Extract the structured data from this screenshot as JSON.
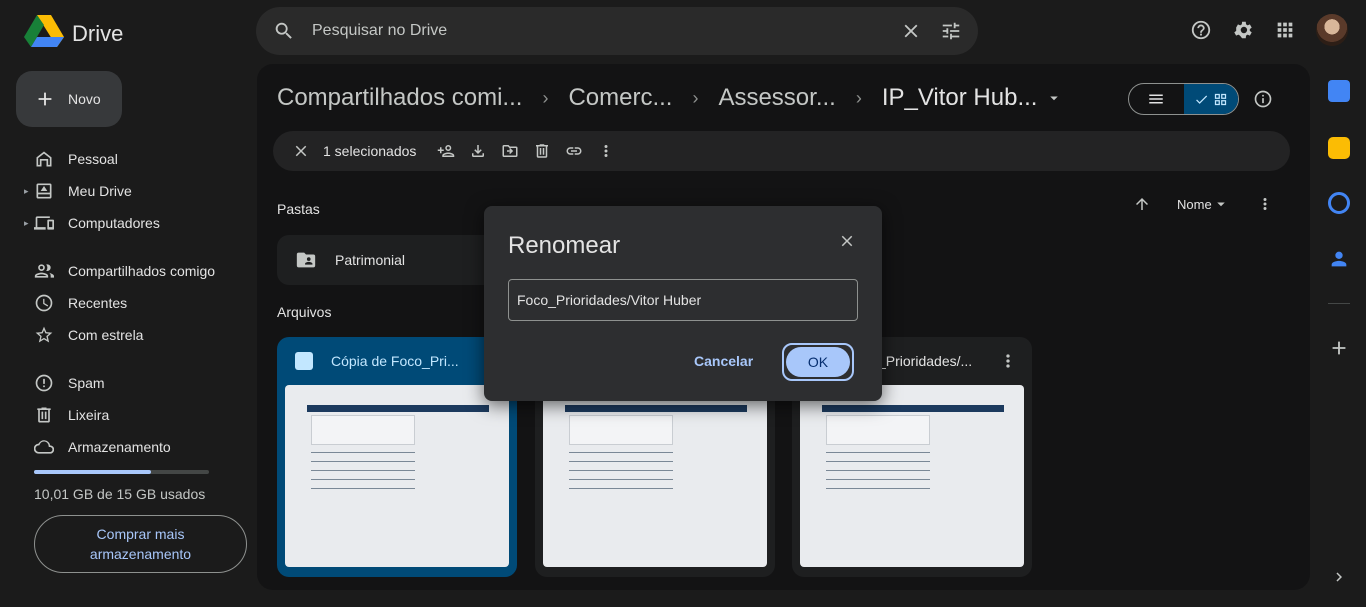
{
  "app": {
    "name": "Drive"
  },
  "search": {
    "placeholder": "Pesquisar no Drive"
  },
  "sidebar": {
    "new_label": "Novo",
    "items": [
      {
        "label": "Pessoal"
      },
      {
        "label": "Meu Drive"
      },
      {
        "label": "Computadores"
      },
      {
        "label": "Compartilhados comigo"
      },
      {
        "label": "Recentes"
      },
      {
        "label": "Com estrela"
      },
      {
        "label": "Spam"
      },
      {
        "label": "Lixeira"
      },
      {
        "label": "Armazenamento"
      }
    ],
    "storage_used_fraction": 0.667,
    "storage_text": "10,01 GB de 15 GB usados",
    "buy_label": "Comprar mais armazenamento"
  },
  "breadcrumb": {
    "items": [
      "Compartilhados comi...",
      "Comerc...",
      "Assessor..."
    ],
    "current": "IP_Vitor Hub..."
  },
  "selection": {
    "count_label": "1 selecionados"
  },
  "sections": {
    "folders": "Pastas",
    "files": "Arquivos"
  },
  "sort": {
    "label": "Nome"
  },
  "folders": [
    {
      "name": "Patrimonial"
    }
  ],
  "files": [
    {
      "name": "Cópia de Foco_Pri..."
    },
    {
      "name": ""
    },
    {
      "name": "_Prioridades/..."
    }
  ],
  "dialog": {
    "title": "Renomear",
    "input_value": "Foco_Prioridades/Vitor Huber",
    "cancel_label": "Cancelar",
    "ok_label": "OK"
  },
  "colors": {
    "accent": "#a8c7fa",
    "selected_card": "#004a77"
  }
}
